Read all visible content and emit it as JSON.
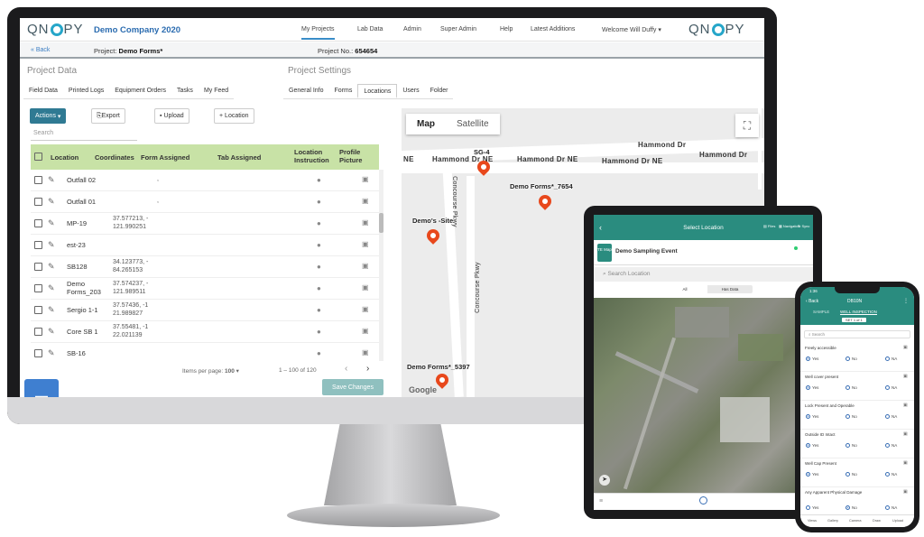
{
  "app": {
    "logo_text_left": "QN",
    "logo_text_right": "PY",
    "company": "Demo Company 2020",
    "nav": [
      "My Projects",
      "Lab Data",
      "Admin",
      "Super Admin",
      "Help",
      "Latest Additions"
    ],
    "user_menu": "Welcome Will Duffy",
    "back": "Back",
    "project_label": "Project:",
    "project_name": "Demo Forms*",
    "project_no_label": "Project No.:",
    "project_no": "654654"
  },
  "project_data": {
    "title": "Project Data",
    "tabs": [
      "Field Data",
      "Printed Logs",
      "Equipment Orders",
      "Tasks",
      "My Feed"
    ]
  },
  "project_settings": {
    "title": "Project Settings",
    "tabs": [
      "General Info",
      "Forms",
      "Locations",
      "Users",
      "Folder"
    ],
    "active_tab": "Locations"
  },
  "toolbar": {
    "actions": "Actions",
    "export": "Export",
    "upload": "Upload",
    "location": "Location",
    "search_placeholder": "Search"
  },
  "table": {
    "headers": {
      "location": "Location",
      "coordinates": "Coordinates",
      "form_assigned": "Form Assigned",
      "tab_assigned": "Tab Assigned",
      "location_instruction_1": "Location",
      "location_instruction_2": "Instruction",
      "profile_picture_1": "Profile",
      "profile_picture_2": "Picture"
    },
    "rows": [
      {
        "location": "Outfall 02",
        "coord1": "",
        "coord2": "",
        "form": ","
      },
      {
        "location": "Outfall 01",
        "coord1": "",
        "coord2": "",
        "form": ","
      },
      {
        "location": "MP-19",
        "coord1": "37.577213, -",
        "coord2": "121.990251",
        "form": ""
      },
      {
        "location": "est-23",
        "coord1": "",
        "coord2": "",
        "form": ""
      },
      {
        "location": "SB128",
        "coord1": "34.123773, -",
        "coord2": "84.265153",
        "form": ""
      },
      {
        "location": "Demo Forms_203",
        "coord1": "37.574237, -",
        "coord2": "121.989511",
        "form": ""
      },
      {
        "location": "Sergio 1-1",
        "coord1": "37.57436, -1",
        "coord2": "21.989827",
        "form": ""
      },
      {
        "location": "Core SB 1",
        "coord1": "37.55481, -1",
        "coord2": "22.021139",
        "form": ""
      },
      {
        "location": "SB-16",
        "coord1": "",
        "coord2": "",
        "form": ""
      }
    ]
  },
  "pager": {
    "items_per_page_label": "Items per page:",
    "items_per_page": "100",
    "range": "1 – 100 of 120"
  },
  "save_button": "Save Changes",
  "map": {
    "type_map": "Map",
    "type_satellite": "Satellite",
    "streets": [
      "Hammond Dr",
      "Hammond Dr NE",
      "Hammond Dr NE",
      "Hammond Dr NE",
      "Hammond Dr",
      "Concourse Pkwy",
      "Concourse Pkwy"
    ],
    "ne_fragment": "NE",
    "pins": [
      "SG-4",
      "Demo Forms*_7654",
      "Demo's -Site",
      "Demo Forms*_5397"
    ],
    "attribution": "Google"
  },
  "tablet": {
    "title": "Select Location",
    "icons": [
      "Files",
      "Navigation",
      "Sync"
    ],
    "event": "Demo Sampling Event",
    "badge": "TE Map",
    "search_placeholder": "Search Location",
    "seg": [
      "All",
      "Has Data"
    ]
  },
  "phone": {
    "time": "1:36",
    "back": "Back",
    "header": "DB10N",
    "tab_left": "SAMPLE",
    "tab_right": "WELL INSPECTION",
    "set_label": "SET 1 of 1",
    "search": "Search",
    "questions": [
      "Freely accessible",
      "Well cover present",
      "Lock Present and Operable",
      "Outside ID Intact",
      "Well Cap Present",
      "Any Apparent Physical Damage"
    ],
    "options": [
      "Yes",
      "No",
      "NA"
    ],
    "bottom_tabs": [
      "Views",
      "Gallery",
      "Camera",
      "Draw",
      "Upload"
    ]
  },
  "colors": {
    "accent_teal": "#2a8c7f",
    "header_green": "#c8e2a6",
    "pin_orange": "#e8481c",
    "link_blue": "#2b6cb0"
  }
}
